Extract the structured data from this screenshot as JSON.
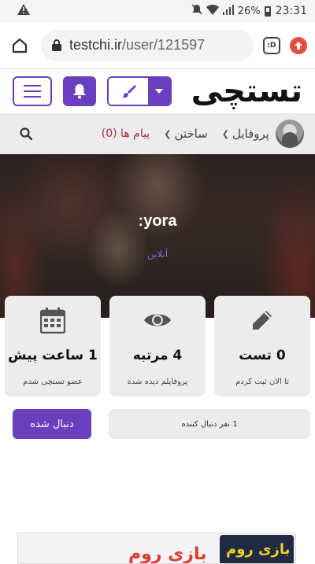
{
  "status_bar": {
    "time": "23:31",
    "battery": "26%"
  },
  "browser": {
    "url_host": "testchi.ir",
    "url_path": "/user/121597",
    "tab_badge": ":D"
  },
  "site": {
    "logo": "تستچی"
  },
  "nav": {
    "profile": "پروفایل",
    "create": "ساختن",
    "messages": "پیام ها (0)"
  },
  "profile": {
    "name": ":yora",
    "status": "آنلاین"
  },
  "stats": [
    {
      "icon": "pencil-icon",
      "value": "0 تست",
      "label": "تا الان ثبت کردم"
    },
    {
      "icon": "eye-icon",
      "value": "4 مرتبه",
      "label": "پروفایلم دیده شده"
    },
    {
      "icon": "calendar-icon",
      "value": "1 ساعت پیش",
      "label": "عضو تستچی شدم"
    }
  ],
  "follow": {
    "button": "دنبال شده",
    "followers": "1 نفر دنبال کننده"
  },
  "ad": {
    "text": "بازی روم",
    "image_text": "بازی روم"
  },
  "colors": {
    "accent": "#6a3fc0",
    "messages": "#a3303a",
    "online": "#8a63e6"
  }
}
